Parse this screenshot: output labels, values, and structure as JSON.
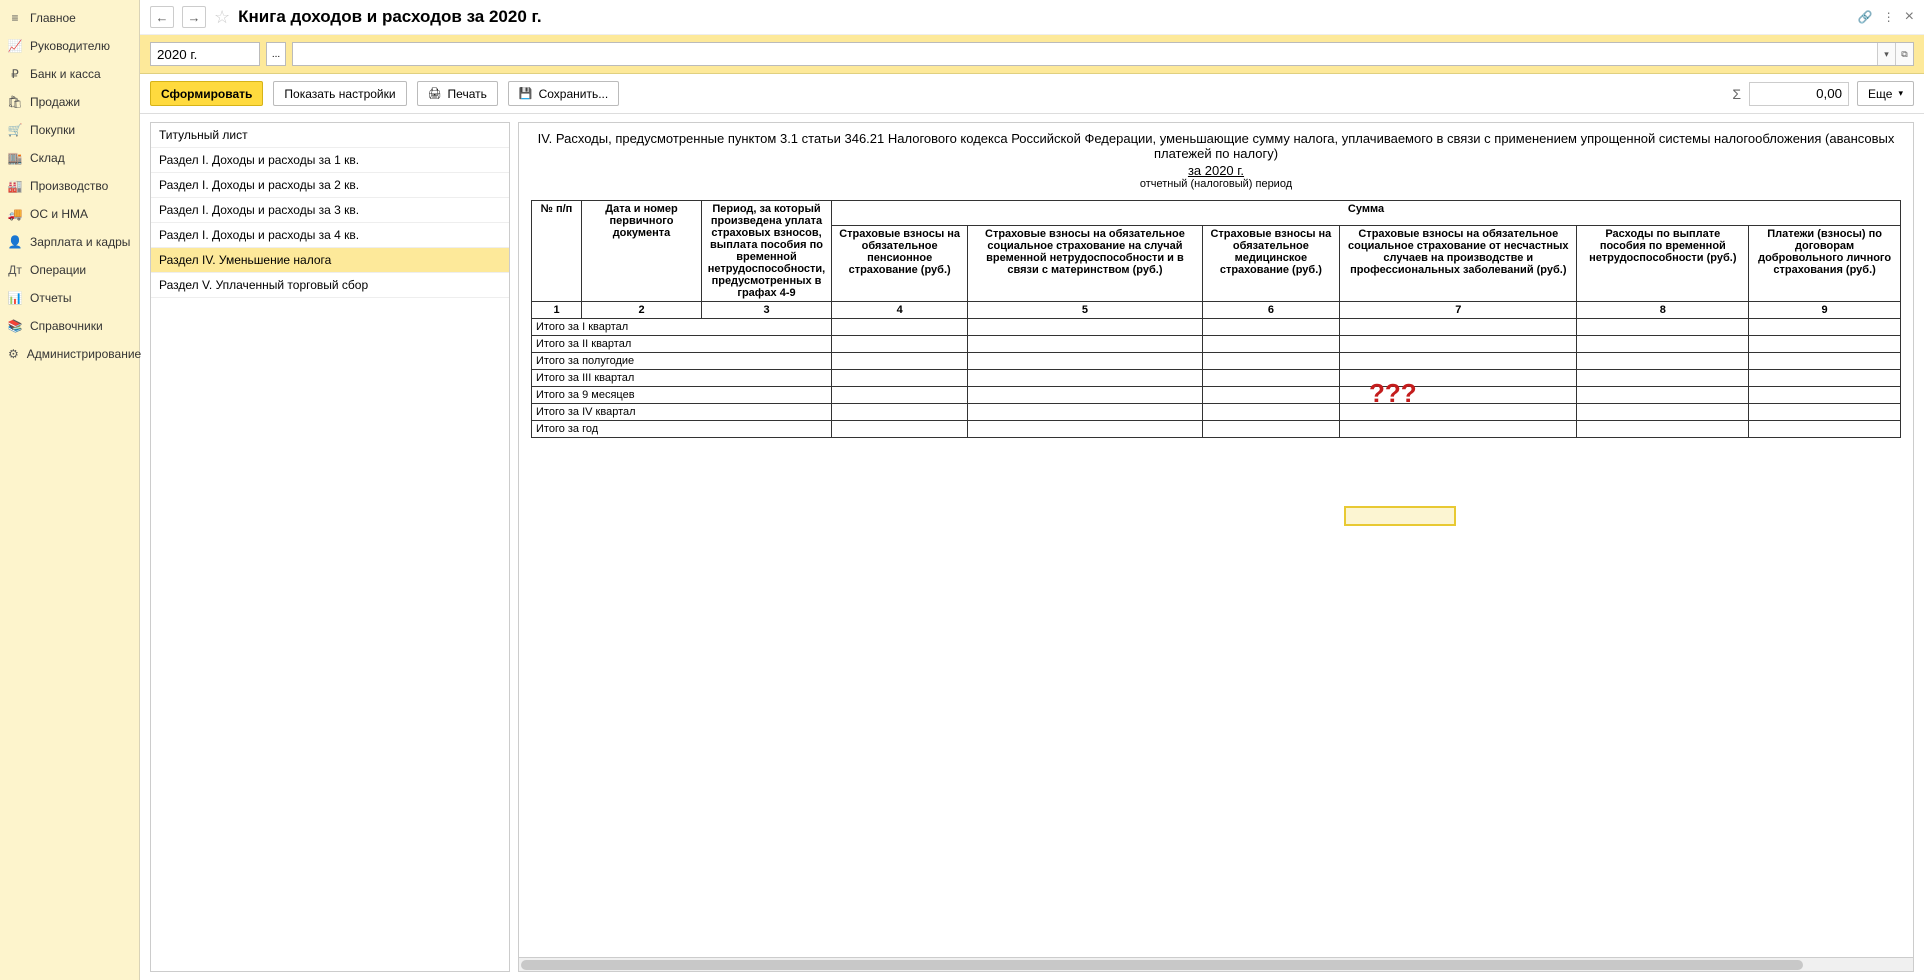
{
  "sidebar": {
    "items": [
      {
        "icon": "≡",
        "label": "Главное"
      },
      {
        "icon": "📈",
        "label": "Руководителю"
      },
      {
        "icon": "₽",
        "label": "Банк и касса"
      },
      {
        "icon": "🛍",
        "label": "Продажи"
      },
      {
        "icon": "🛒",
        "label": "Покупки"
      },
      {
        "icon": "🏬",
        "label": "Склад"
      },
      {
        "icon": "🏭",
        "label": "Производство"
      },
      {
        "icon": "🚚",
        "label": "ОС и НМА"
      },
      {
        "icon": "👤",
        "label": "Зарплата и кадры"
      },
      {
        "icon": "Дт",
        "label": "Операции"
      },
      {
        "icon": "📊",
        "label": "Отчеты"
      },
      {
        "icon": "📚",
        "label": "Справочники"
      },
      {
        "icon": "⚙",
        "label": "Администрирование"
      }
    ]
  },
  "header": {
    "back": "←",
    "forward": "→",
    "title": "Книга доходов и расходов за 2020 г.",
    "link": "🔗",
    "menu": "⋮",
    "close": "×"
  },
  "filter": {
    "period": "2020 г.",
    "ellipsis": "...",
    "dropdown": "▾",
    "popout": "⧉"
  },
  "toolbar": {
    "form": "Сформировать",
    "settings": "Показать настройки",
    "print_icon": "🖨",
    "print": "Печать",
    "save_icon": "💾",
    "save": "Сохранить...",
    "sigma": "Σ",
    "sum": "0,00",
    "more": "Еще",
    "more_arr": "▾"
  },
  "sections": [
    {
      "label": "Титульный лист"
    },
    {
      "label": "Раздел I. Доходы и расходы за 1 кв."
    },
    {
      "label": "Раздел I. Доходы и расходы за 2 кв."
    },
    {
      "label": "Раздел I. Доходы и расходы за 3 кв."
    },
    {
      "label": "Раздел I. Доходы и расходы за 4 кв."
    },
    {
      "label": "Раздел IV. Уменьшение налога",
      "selected": true
    },
    {
      "label": "Раздел V. Уплаченный торговый сбор"
    }
  ],
  "report": {
    "heading": "IV. Расходы, предусмотренные пунктом 3.1 статьи 346.21 Налогового кодекса Российской Федерации, уменьшающие сумму налога, уплачиваемого в связи с применением упрощенной системы налогообложения (авансовых платежей по налогу)",
    "period_label": "за 2020 г.",
    "subhead": "отчетный (налоговый) период",
    "cols": {
      "c1": "№ п/п",
      "c2": "Дата и номер первичного документа",
      "c3": "Период, за который произведена уплата страховых взносов, выплата пособия по временной нетрудоспособности, предусмотренных в графах 4-9",
      "sum_header": "Сумма",
      "c4": "Страховые взносы на обязательное пенсионное страхование (руб.)",
      "c5": "Страховые взносы на обязательное социальное страхование на случай временной нетрудоспособности и в связи с материнством (руб.)",
      "c6": "Страховые взносы на обязательное медицинское страхование (руб.)",
      "c7": "Страховые взносы на обязательное социальное страхование от несчастных случаев на производстве и профессиональных заболеваний (руб.)",
      "c8": "Расходы по выплате пособия по временной нетрудоспособности (руб.)",
      "c9": "Платежи (взносы) по договорам добровольного личного страхования (руб.)"
    },
    "nums": {
      "n1": "1",
      "n2": "2",
      "n3": "3",
      "n4": "4",
      "n5": "5",
      "n6": "6",
      "n7": "7",
      "n8": "8",
      "n9": "9"
    },
    "rows": [
      {
        "label": "Итого за I квартал"
      },
      {
        "label": "Итого за II квартал"
      },
      {
        "label": "Итого за полугодие"
      },
      {
        "label": "Итого за III квартал"
      },
      {
        "label": "Итого за 9 месяцев"
      },
      {
        "label": "Итого за IV квартал"
      },
      {
        "label": "Итого за год"
      }
    ],
    "annotation": "???"
  }
}
